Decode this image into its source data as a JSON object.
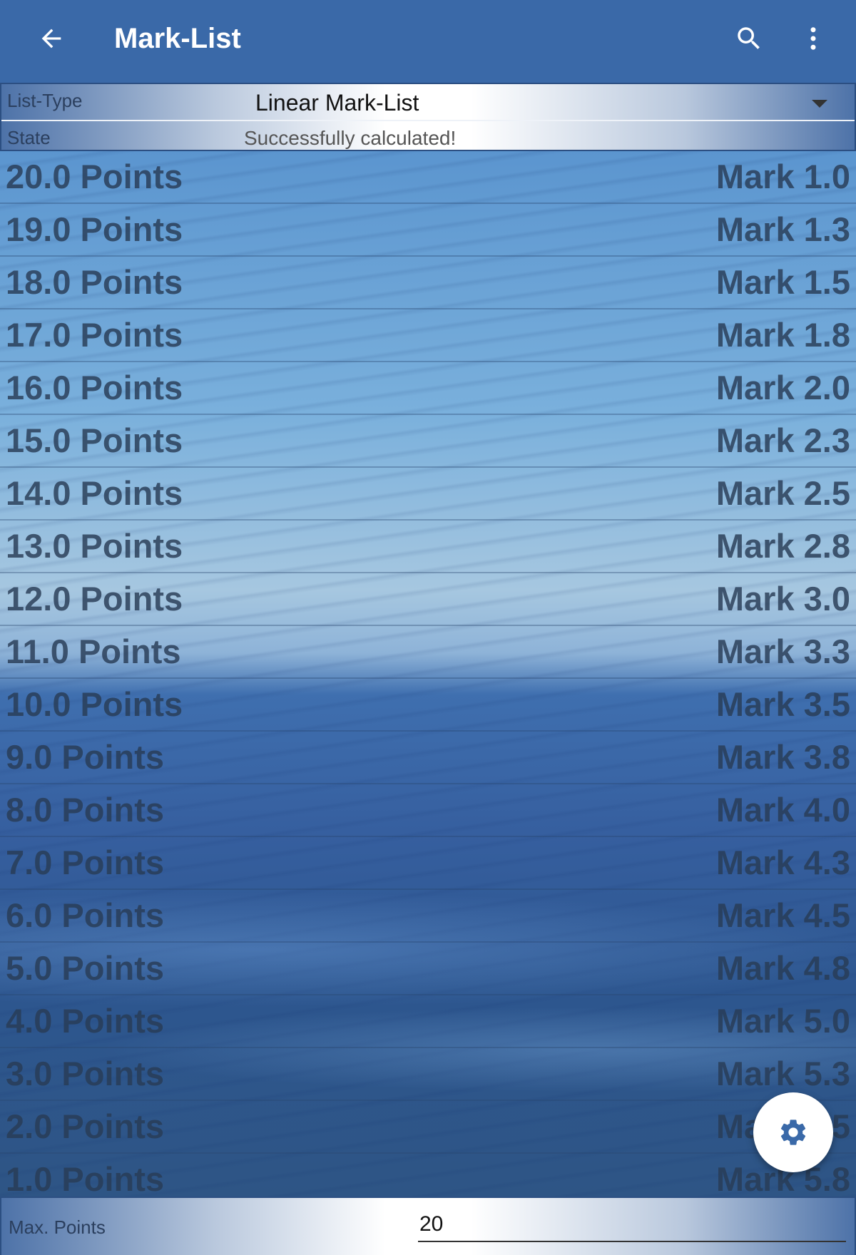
{
  "appbar": {
    "title": "Mark-List",
    "back_icon": "arrow-back-icon",
    "search_icon": "search-icon",
    "more_icon": "more-vert-icon"
  },
  "header": {
    "list_type_label": "List-Type",
    "list_type_value": "Linear Mark-List",
    "state_label": "State",
    "state_value": "Successfully calculated!"
  },
  "list": {
    "rows": [
      {
        "points": "20.0 Points",
        "mark": "Mark 1.0"
      },
      {
        "points": "19.0 Points",
        "mark": "Mark 1.3"
      },
      {
        "points": "18.0 Points",
        "mark": "Mark 1.5"
      },
      {
        "points": "17.0 Points",
        "mark": "Mark 1.8"
      },
      {
        "points": "16.0 Points",
        "mark": "Mark 2.0"
      },
      {
        "points": "15.0 Points",
        "mark": "Mark 2.3"
      },
      {
        "points": "14.0 Points",
        "mark": "Mark 2.5"
      },
      {
        "points": "13.0 Points",
        "mark": "Mark 2.8"
      },
      {
        "points": "12.0 Points",
        "mark": "Mark 3.0"
      },
      {
        "points": "11.0 Points",
        "mark": "Mark 3.3"
      },
      {
        "points": "10.0 Points",
        "mark": "Mark 3.5"
      },
      {
        "points": "9.0 Points",
        "mark": "Mark 3.8"
      },
      {
        "points": "8.0 Points",
        "mark": "Mark 4.0"
      },
      {
        "points": "7.0 Points",
        "mark": "Mark 4.3"
      },
      {
        "points": "6.0 Points",
        "mark": "Mark 4.5"
      },
      {
        "points": "5.0 Points",
        "mark": "Mark 4.8"
      },
      {
        "points": "4.0 Points",
        "mark": "Mark 5.0"
      },
      {
        "points": "3.0 Points",
        "mark": "Mark 5.3"
      },
      {
        "points": "2.0 Points",
        "mark": "Mark 5.5"
      },
      {
        "points": "1.0 Points",
        "mark": "Mark 5.8"
      }
    ]
  },
  "fab": {
    "icon": "settings-gear-icon"
  },
  "footer": {
    "max_points_label": "Max. Points",
    "max_points_value": "20"
  },
  "colors": {
    "appbar": "#3a69a8",
    "fab_icon": "#3a69a8",
    "row_text": "#28405a"
  }
}
